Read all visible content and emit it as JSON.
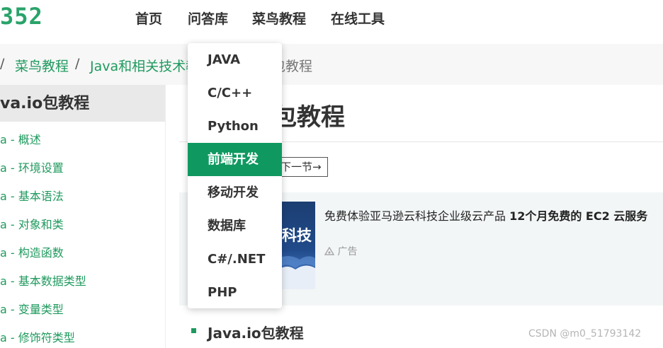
{
  "header": {
    "logo": "352",
    "nav": [
      "首页",
      "问答库",
      "菜鸟教程",
      "在线工具"
    ]
  },
  "breadcrumb": {
    "sep": "/",
    "items": [
      "菜鸟教程",
      "Java和相关技术教"
    ],
    "current": "包教程"
  },
  "sidebar": {
    "title": "va.io包教程",
    "items": [
      "a - 概述",
      "a - 环境设置",
      "a - 基本语法",
      "a - 对象和类",
      "a - 构造函数",
      "a - 基本数据类型",
      "a - 变量类型",
      "a - 修饰符类型"
    ]
  },
  "main": {
    "title": "包教程",
    "next_button": "下一节→"
  },
  "ad": {
    "image_text": "科技",
    "text": "免费体验亚马逊云科技企业级云产品 ",
    "text_bold": "12个月免费的 EC2 云服务",
    "label": "广告"
  },
  "toc": {
    "first_item": "Java.io包教程"
  },
  "watermark": "CSDN @m0_51793142",
  "dropdown": {
    "items": [
      "JAVA",
      "C/C++",
      "Python",
      "前端开发",
      "移动开发",
      "数据库",
      "C#/.NET",
      "PHP"
    ],
    "active_index": 3
  },
  "colors": {
    "accent": "#1f9a5e",
    "active_bg": "#0f9960"
  }
}
